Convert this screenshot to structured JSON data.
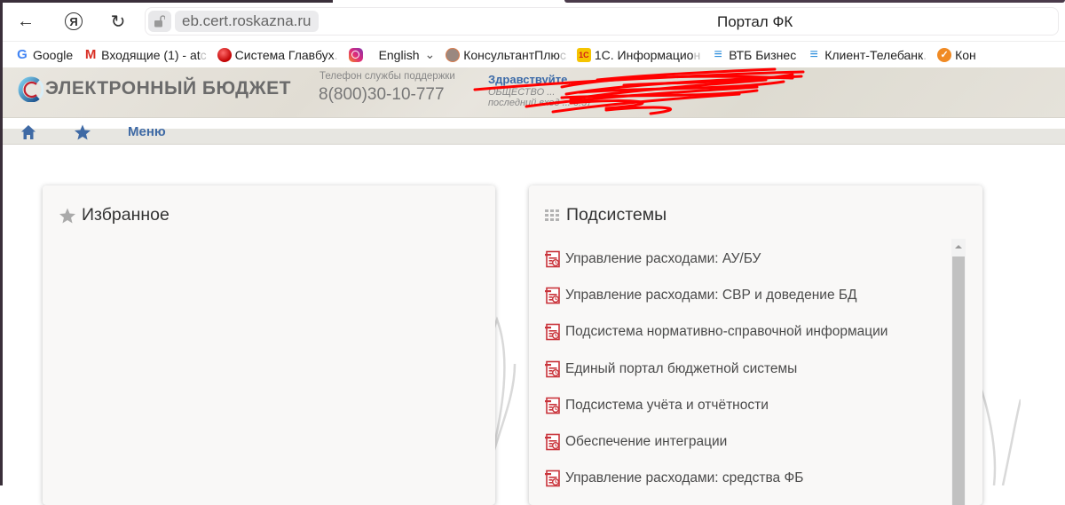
{
  "browser": {
    "url": "eb.cert.roskazna.ru",
    "page_title": "Портал ФК",
    "icons": {
      "back": "back-arrow-icon",
      "yandex": "yandex-icon",
      "reload": "reload-icon",
      "lock": "unlocked-padlock-icon"
    },
    "back_glyph": "←",
    "yandex_glyph": "Я",
    "reload_glyph": "↻"
  },
  "bookmarks": [
    {
      "label": "Google",
      "icon": "google-icon",
      "glyph": "G"
    },
    {
      "label": "Входящие (1) - at",
      "fade": "c",
      "icon": "gmail-icon",
      "glyph": "M"
    },
    {
      "label": "Система Главбух",
      "fade": ".",
      "icon": "glavbukh-icon",
      "glyph": ""
    },
    {
      "label": "",
      "icon": "instagram-icon",
      "glyph": ""
    },
    {
      "label": "English",
      "suffix": "⌄",
      "icon": "",
      "glyph": ""
    },
    {
      "label": "КонсультантПлю",
      "fade": "с",
      "icon": "consultant-icon",
      "glyph": ""
    },
    {
      "label": "1С. Информацио",
      "fade": "н",
      "icon": "1c-icon",
      "glyph": "1С"
    },
    {
      "label": "ВТБ Бизнес",
      "icon": "vtb-icon",
      "glyph": "≡"
    },
    {
      "label": "Клиент-Телебанк",
      "fade": ".",
      "icon": "vtb-icon",
      "glyph": "≡"
    },
    {
      "label": "Кон",
      "icon": "kontur-icon",
      "glyph": "✓"
    }
  ],
  "site_header": {
    "logo_text": "ЭЛЕКТРОННЫЙ БЮДЖЕТ",
    "support_label": "Телефон службы поддержки",
    "support_phone": "8(800)30-10-777",
    "greeting": "Здравствуйте, ",
    "org_line": "ОБЩЕСТВО ...",
    "last_login": "последний вход ... 6:57"
  },
  "nav": {
    "menu_label": "Меню"
  },
  "favorites_panel": {
    "title": "Избранное",
    "items": []
  },
  "subsystems_panel": {
    "title": "Подсистемы",
    "items": [
      "Управление расходами: АУ/БУ",
      "Управление расходами: СВР и доведение БД",
      "Подсистема нормативно-справочной информации",
      "Единый портал бюджетной системы",
      "Подсистема учёта и отчётности",
      "Обеспечение интеграции",
      "Управление расходами: средства ФБ"
    ]
  },
  "colors": {
    "brand_blue": "#3f6aa5",
    "doc_icon_red": "#c9343b",
    "header_bg": "#e5e2da",
    "panel_bg": "#f9f8f7"
  }
}
